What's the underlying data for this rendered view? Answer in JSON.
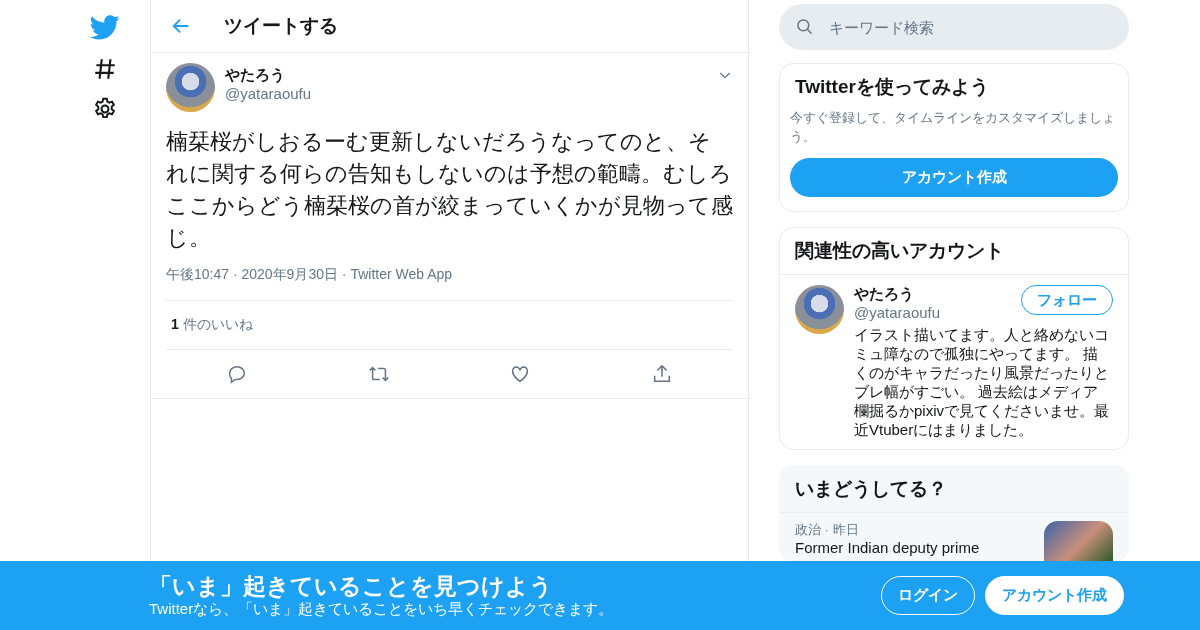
{
  "header": {
    "title": "ツイートする"
  },
  "tweet": {
    "author": {
      "name": "やたろう",
      "handle": "@yataraoufu"
    },
    "text": "楠栞桜がしおるーむ更新しないだろうなってのと、それに関する何らの告知もしないのは予想の範疇。むしろここからどう楠栞桜の首が絞まっていくかが見物って感じ。",
    "meta": "午後10:47 · 2020年9月30日 · Twitter Web App",
    "likes": {
      "count": "1",
      "label": "件のいいね"
    }
  },
  "search": {
    "placeholder": "キーワード検索"
  },
  "signup_card": {
    "title": "Twitterを使ってみよう",
    "description": "今すぐ登録して、タイムラインをカスタマイズしましょう。",
    "button": "アカウント作成"
  },
  "related": {
    "title": "関連性の高いアカウント",
    "accounts": [
      {
        "name": "やたろう",
        "handle": "@yataraoufu",
        "follow_button": "フォロー",
        "bio": "イラスト描いてます。人と絡めないコミュ障なので孤独にやってます。 描くのがキャラだったり風景だったりとブレ幅がすごい。 過去絵はメディア欄掘るかpixivで見てくださいませ。最近Vtuberにはまりました。"
      }
    ]
  },
  "trends": {
    "title": "いまどうしてる？",
    "items": [
      {
        "context": "政治 · 昨日",
        "title": "Former Indian deputy prime"
      }
    ]
  },
  "bottom_bar": {
    "title": "「いま」起きていることを見つけよう",
    "subtitle": "Twitterなら、「いま」起きていることをいち早くチェックできます。",
    "login_button": "ログイン",
    "signup_button": "アカウント作成"
  }
}
